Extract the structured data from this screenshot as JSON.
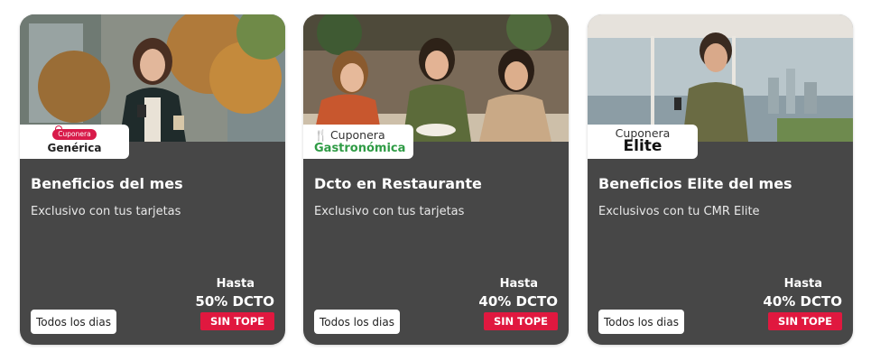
{
  "cards": [
    {
      "brand": {
        "pill": "Cuponera",
        "name": "Genérica"
      },
      "title": "Beneficios del mes",
      "subtitle": "Exclusivo con tus tarjetas",
      "days": "Todos los dias",
      "promo": {
        "hasta": "Hasta",
        "discount": "50% DCTO",
        "tag": "SIN TOPE"
      },
      "photo_icon": "woman-with-phone-and-coffee-photo"
    },
    {
      "brand": {
        "label": "Cuponera",
        "name": "Gastronómica",
        "icon": "utensils-icon"
      },
      "title": "Dcto en Restaurante",
      "subtitle": "Exclusivo con tus tarjetas",
      "days": "Todos los dias",
      "promo": {
        "hasta": "Hasta",
        "discount": "40% DCTO",
        "tag": "SIN TOPE"
      },
      "photo_icon": "three-women-at-restaurant-photo"
    },
    {
      "brand": {
        "label": "Cuponera",
        "name": "Elite"
      },
      "title": "Beneficios Elite del mes",
      "subtitle": "Exclusivos con tu CMR Elite",
      "days": "Todos los dias",
      "promo": {
        "hasta": "Hasta",
        "discount": "40% DCTO",
        "tag": "SIN TOPE"
      },
      "photo_icon": "man-with-phone-office-photo"
    }
  ],
  "colors": {
    "card_bg": "#474747",
    "accent_red": "#e0183f",
    "generica_pink": "#d81b4a",
    "gastro_green": "#2f9b45"
  }
}
